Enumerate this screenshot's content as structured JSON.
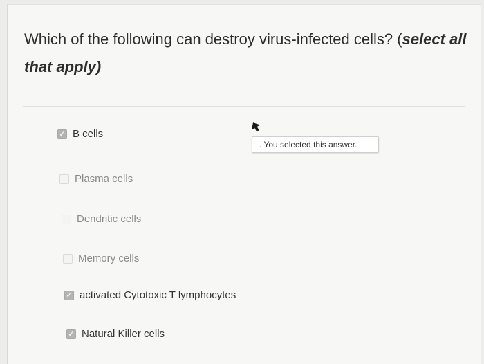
{
  "question": {
    "text_main": "Which of the following can destroy virus-infected cells? (",
    "text_emph": "select all that apply)"
  },
  "answers": [
    {
      "label": "B cells",
      "checked": true
    },
    {
      "label": "Plasma cells",
      "checked": false
    },
    {
      "label": "Dendritic cells",
      "checked": false
    },
    {
      "label": "Memory cells",
      "checked": false
    },
    {
      "label": "activated Cytotoxic T lymphocytes",
      "checked": true
    },
    {
      "label": "Natural Killer cells",
      "checked": true
    }
  ],
  "tooltip": {
    "text": ". You selected this answer."
  },
  "icons": {
    "checkmark": "checkmark-icon",
    "cursor": "mouse-cursor-icon"
  },
  "colors": {
    "checked_box": "#b4b4b2",
    "text": "#2d2d2d",
    "muted_text": "#8a8a88"
  }
}
